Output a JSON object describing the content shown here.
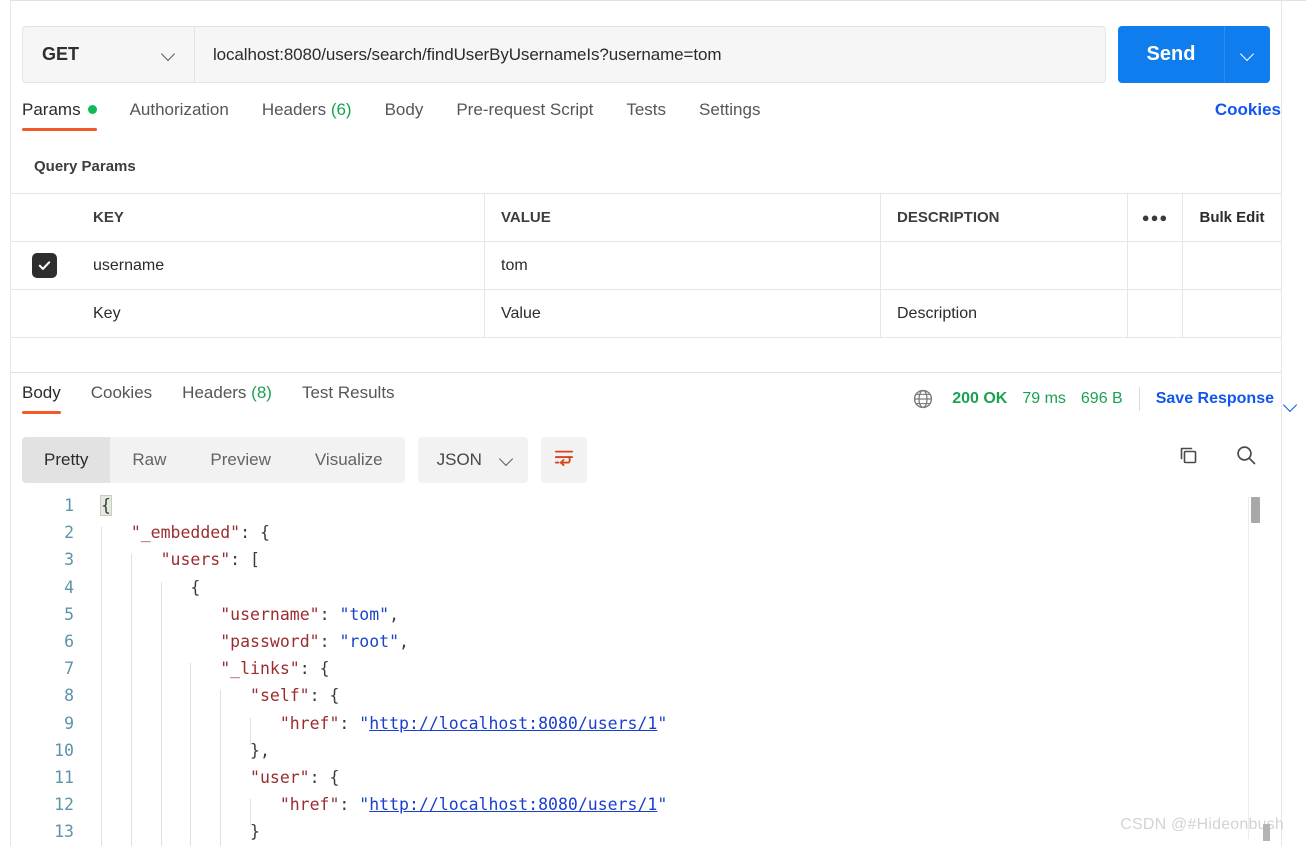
{
  "request": {
    "method": "GET",
    "url": "localhost:8080/users/search/findUserByUsernameIs?username=tom",
    "send_label": "Send",
    "tabs": [
      {
        "label": "Params",
        "dot": true
      },
      {
        "label": "Authorization"
      },
      {
        "label": "Headers",
        "count": "(6)"
      },
      {
        "label": "Body"
      },
      {
        "label": "Pre-request Script"
      },
      {
        "label": "Tests"
      },
      {
        "label": "Settings"
      }
    ],
    "cookies_link": "Cookies"
  },
  "query_params": {
    "section_title": "Query Params",
    "columns": [
      "KEY",
      "VALUE",
      "DESCRIPTION"
    ],
    "bulk_edit": "Bulk Edit",
    "rows": [
      {
        "checked": true,
        "key": "username",
        "value": "tom",
        "description": ""
      }
    ],
    "placeholder_row": {
      "key": "Key",
      "value": "Value",
      "description": "Description"
    }
  },
  "response": {
    "tabs": [
      {
        "label": "Body"
      },
      {
        "label": "Cookies"
      },
      {
        "label": "Headers",
        "count": "(8)"
      },
      {
        "label": "Test Results"
      }
    ],
    "status": "200 OK",
    "time": "79 ms",
    "size": "696 B",
    "save_label": "Save Response",
    "view_modes": [
      "Pretty",
      "Raw",
      "Preview",
      "Visualize"
    ],
    "active_view": "Pretty",
    "format": "JSON"
  },
  "code": {
    "lines": [
      {
        "n": "1",
        "indent": 0,
        "tokens": [
          {
            "t": "{",
            "c": "p",
            "hl": true
          }
        ]
      },
      {
        "n": "2",
        "indent": 1,
        "tokens": [
          {
            "t": "\"_embedded\"",
            "c": "k"
          },
          {
            "t": ": ",
            "c": "p"
          },
          {
            "t": "{",
            "c": "p"
          }
        ]
      },
      {
        "n": "3",
        "indent": 2,
        "tokens": [
          {
            "t": "\"users\"",
            "c": "k"
          },
          {
            "t": ": ",
            "c": "p"
          },
          {
            "t": "[",
            "c": "p"
          }
        ]
      },
      {
        "n": "4",
        "indent": 3,
        "tokens": [
          {
            "t": "{",
            "c": "p"
          }
        ]
      },
      {
        "n": "5",
        "indent": 4,
        "tokens": [
          {
            "t": "\"username\"",
            "c": "k"
          },
          {
            "t": ": ",
            "c": "p"
          },
          {
            "t": "\"tom\"",
            "c": "s"
          },
          {
            "t": ",",
            "c": "p"
          }
        ]
      },
      {
        "n": "6",
        "indent": 4,
        "tokens": [
          {
            "t": "\"password\"",
            "c": "k"
          },
          {
            "t": ": ",
            "c": "p"
          },
          {
            "t": "\"root\"",
            "c": "s"
          },
          {
            "t": ",",
            "c": "p"
          }
        ]
      },
      {
        "n": "7",
        "indent": 4,
        "tokens": [
          {
            "t": "\"_links\"",
            "c": "k"
          },
          {
            "t": ": ",
            "c": "p"
          },
          {
            "t": "{",
            "c": "p"
          }
        ]
      },
      {
        "n": "8",
        "indent": 5,
        "tokens": [
          {
            "t": "\"self\"",
            "c": "k"
          },
          {
            "t": ": ",
            "c": "p"
          },
          {
            "t": "{",
            "c": "p"
          }
        ]
      },
      {
        "n": "9",
        "indent": 6,
        "tokens": [
          {
            "t": "\"href\"",
            "c": "k"
          },
          {
            "t": ": ",
            "c": "p"
          },
          {
            "t": "\"",
            "c": "s"
          },
          {
            "t": "http://localhost:8080/users/1",
            "c": "lnk"
          },
          {
            "t": "\"",
            "c": "s"
          }
        ]
      },
      {
        "n": "10",
        "indent": 5,
        "tokens": [
          {
            "t": "}",
            "c": "p"
          },
          {
            "t": ",",
            "c": "p"
          }
        ]
      },
      {
        "n": "11",
        "indent": 5,
        "tokens": [
          {
            "t": "\"user\"",
            "c": "k"
          },
          {
            "t": ": ",
            "c": "p"
          },
          {
            "t": "{",
            "c": "p"
          }
        ]
      },
      {
        "n": "12",
        "indent": 6,
        "tokens": [
          {
            "t": "\"href\"",
            "c": "k"
          },
          {
            "t": ": ",
            "c": "p"
          },
          {
            "t": "\"",
            "c": "s"
          },
          {
            "t": "http://localhost:8080/users/1",
            "c": "lnk"
          },
          {
            "t": "\"",
            "c": "s"
          }
        ]
      },
      {
        "n": "13",
        "indent": 5,
        "tokens": [
          {
            "t": "}",
            "c": "p"
          }
        ]
      }
    ]
  },
  "watermark": "CSDN @#Hideonbush",
  "colors": {
    "accent_orange": "#f05a28",
    "send_blue": "#0f7ded",
    "link_blue": "#1156ee",
    "status_green": "#1aa251",
    "dot_green": "#10b95a"
  }
}
